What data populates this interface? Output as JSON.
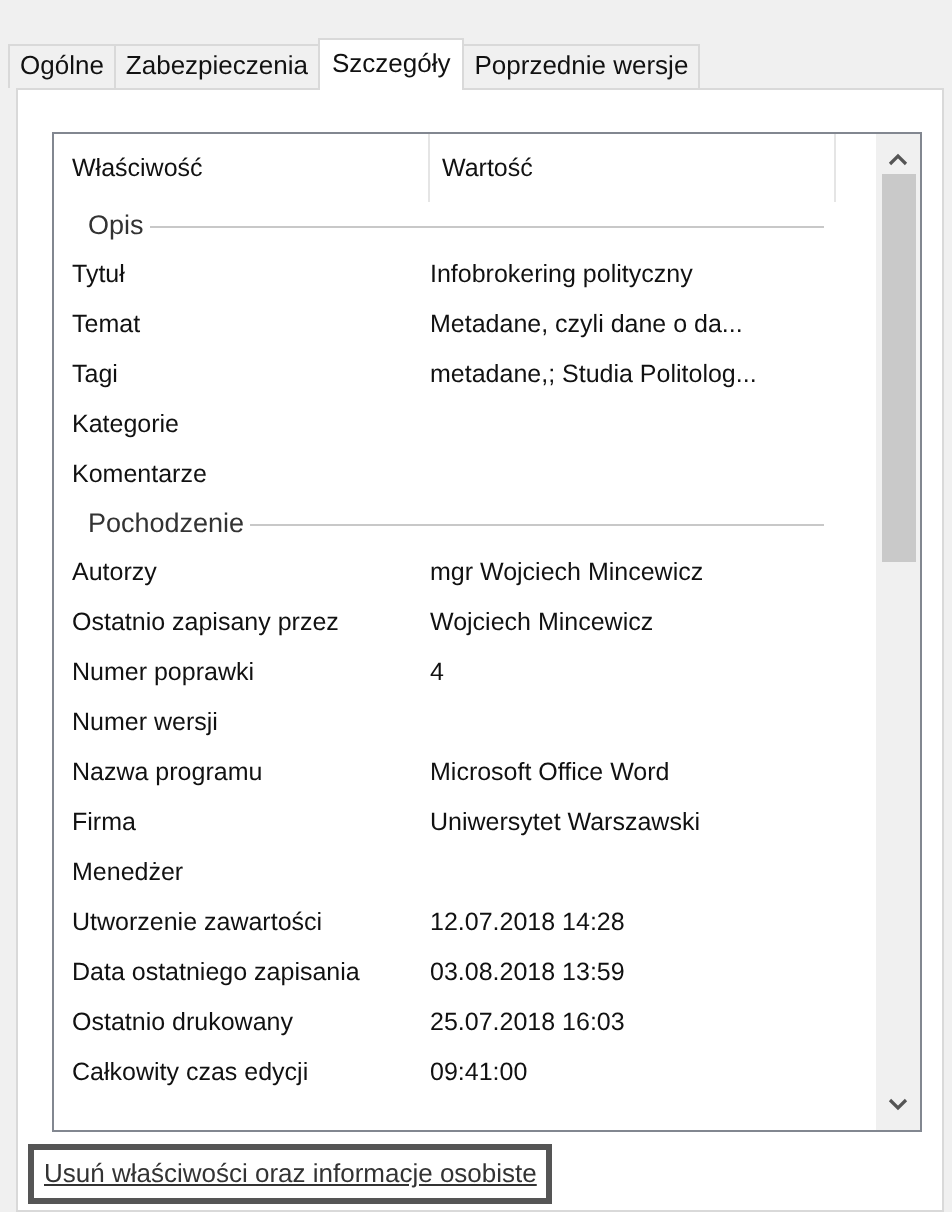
{
  "tabs": [
    {
      "label": "Ogólne",
      "selected": false
    },
    {
      "label": "Zabezpieczenia",
      "selected": false
    },
    {
      "label": "Szczegóły",
      "selected": true
    },
    {
      "label": "Poprzednie wersje",
      "selected": false
    }
  ],
  "table": {
    "columns": [
      "Właściwość",
      "Wartość"
    ],
    "rows": [
      {
        "kind": "group",
        "label": "Opis"
      },
      {
        "kind": "row",
        "property": "Tytuł",
        "value": "Infobrokering polityczny"
      },
      {
        "kind": "row",
        "property": "Temat",
        "value": "Metadane, czyli dane o da..."
      },
      {
        "kind": "row",
        "property": "Tagi",
        "value": "metadane,; Studia Politolog..."
      },
      {
        "kind": "row",
        "property": "Kategorie"
      },
      {
        "kind": "row",
        "property": "Komentarze"
      },
      {
        "kind": "group",
        "label": "Pochodzenie"
      },
      {
        "kind": "row",
        "property": "Autorzy",
        "value": "mgr Wojciech Mincewicz"
      },
      {
        "kind": "row",
        "property": "Ostatnio zapisany przez",
        "value": "Wojciech Mincewicz"
      },
      {
        "kind": "row",
        "property": "Numer poprawki",
        "value": "4"
      },
      {
        "kind": "row",
        "property": "Numer wersji"
      },
      {
        "kind": "row",
        "property": "Nazwa programu",
        "value": "Microsoft Office Word"
      },
      {
        "kind": "row",
        "property": "Firma",
        "value": "Uniwersytet Warszawski"
      },
      {
        "kind": "row",
        "property": "Menedżer"
      },
      {
        "kind": "row",
        "property": "Utworzenie zawartości",
        "value": "12.07.2018 14:28"
      },
      {
        "kind": "row",
        "property": "Data ostatniego zapisania",
        "value": "03.08.2018 13:59"
      },
      {
        "kind": "row",
        "property": "Ostatnio drukowany",
        "value": "25.07.2018 16:03"
      },
      {
        "kind": "row",
        "property": "Całkowity czas edycji",
        "value": "09:41:00"
      }
    ]
  },
  "link": "Usuń właściwości oraz informacje osobiste"
}
